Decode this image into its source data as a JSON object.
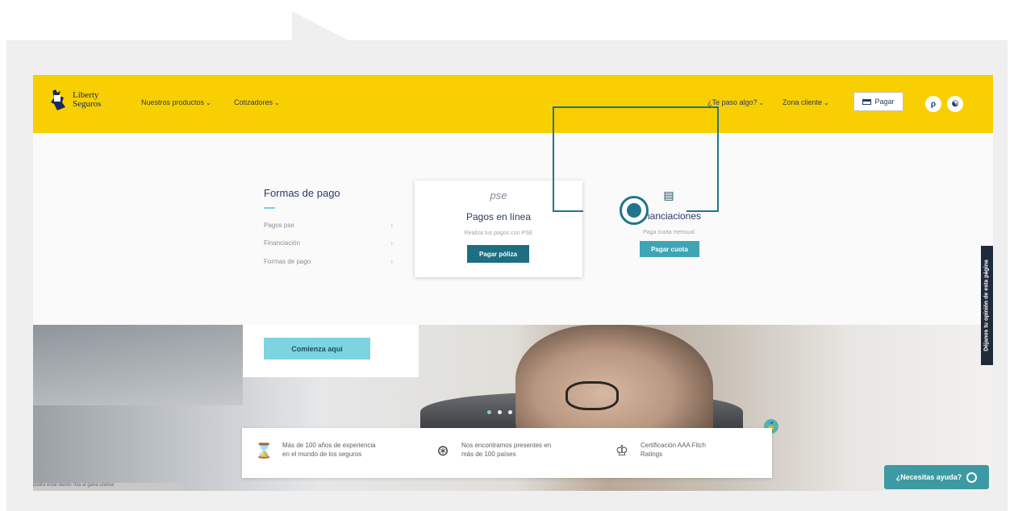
{
  "brand": {
    "name_line1": "Liberty",
    "name_line2": "Seguros"
  },
  "nav": {
    "left": [
      {
        "label": "Nuestros productos",
        "chevron": "⌄"
      },
      {
        "label": "Cotizadores",
        "chevron": "⌄"
      }
    ],
    "right": [
      {
        "label": "¿Te paso algo?",
        "chevron": "⌄"
      },
      {
        "label": "Zona cliente",
        "chevron": "⌄"
      }
    ],
    "pay_label": "Pagar",
    "search_icon_glyph": "ρ",
    "accessibility_icon_glyph": "☯"
  },
  "dropdown": {
    "section_title": "Formas de pago",
    "menu_items": [
      {
        "label": "Pagos pse",
        "arrow": "›"
      },
      {
        "label": "Financiación",
        "arrow": "›"
      },
      {
        "label": "Formas de pago",
        "arrow": "›"
      }
    ],
    "cards": [
      {
        "icon_text": "pse",
        "title": "Pagos en línea",
        "subtitle": "Realiza tus pagos con PSE",
        "button": "Pagar póliza"
      },
      {
        "icon_text": "▤",
        "title": "Financiaciones",
        "subtitle": "Paga cuota mensual",
        "button": "Pagar cuota"
      }
    ]
  },
  "hero": {
    "cta_button": "Comienza aquí",
    "badge_icon": "🏅"
  },
  "info_bar": [
    {
      "icon": "⌛",
      "line1": "Más de 100 años de experiencia",
      "line2": "en el mundo de los seguros"
    },
    {
      "icon": "⊛",
      "line1": "Nos encontramos presentes en",
      "line2": "más de 100 países"
    },
    {
      "icon": "♔",
      "line1": "Certificación AAA Fitch",
      "line2": "Ratings"
    }
  ],
  "side_tab": "Déjanos tu opinión de esta página",
  "help_button": "¿Necesitas ayuda?",
  "bottom_text": "podrá estal diento l'Ba al gana ununur",
  "colors": {
    "brand_yellow": "#f8cf00",
    "navy": "#2b3a68",
    "teal_dark": "#1d6e80",
    "teal_light": "#3da5b6",
    "highlight": "#20758c"
  }
}
